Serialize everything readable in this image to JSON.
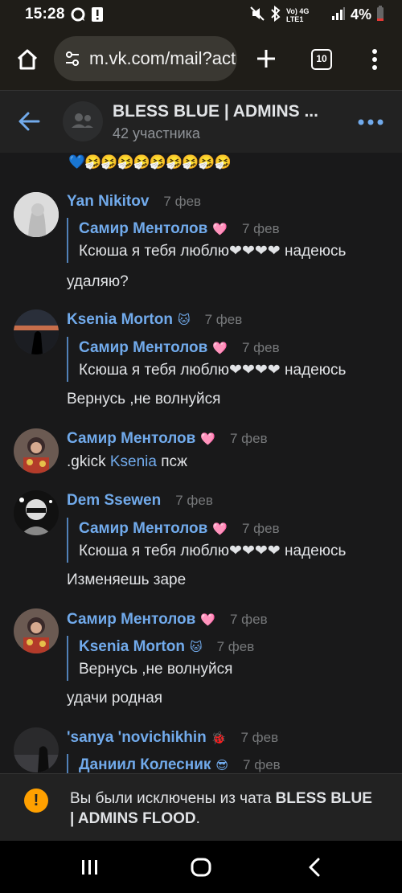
{
  "status_bar": {
    "time": "15:28",
    "network": "Vo) 4G LTE1",
    "battery": "4%"
  },
  "browser": {
    "url": "m.vk.com/mail?act",
    "tab_count": "10"
  },
  "chat": {
    "title": "BLESS BLUE | ADMINS ...",
    "subtitle": "42 участника"
  },
  "messages": {
    "top_emoji": "💙🤧🤧🤧🤧🤧🤧🤧🤧🤧",
    "m1": {
      "author": "Yan Nikitov",
      "date": "7 фев",
      "reply_author": "Самир Ментолов",
      "reply_badge": "🩷",
      "reply_date": "7 фев",
      "reply_text": "Ксюша я тебя люблю❤❤❤❤ надеюсь",
      "text": "удаляю?"
    },
    "m2": {
      "author": "Ksenia Morton",
      "badge": "🐱",
      "date": "7 фев",
      "reply_author": "Самир Ментолов",
      "reply_badge": "🩷",
      "reply_date": "7 фев",
      "reply_text": "Ксюша я тебя люблю❤❤❤❤ надеюсь",
      "text": "Вернусь ,не волнуйся"
    },
    "m3": {
      "author": "Самир Ментолов",
      "badge": "🩷",
      "date": "7 фев",
      "text_prefix": ".gkick ",
      "mention": "Ksenia",
      "text_suffix": " псж"
    },
    "m4": {
      "author": "Dem Ssewen",
      "date": "7 фев",
      "reply_author": "Самир Ментолов",
      "reply_badge": "🩷",
      "reply_date": "7 фев",
      "reply_text": "Ксюша я тебя люблю❤❤❤❤ надеюсь",
      "text": "Изменяешь заре"
    },
    "m5": {
      "author": "Самир Ментолов",
      "badge": "🩷",
      "date": "7 фев",
      "reply_author": "Ksenia Morton",
      "reply_badge": "🐱",
      "reply_date": "7 фев",
      "reply_text": "Вернусь ,не волнуйся",
      "text": "удачи родная"
    },
    "m6": {
      "author": "'sanya 'novichikhin",
      "badge": "🐞",
      "date": "7 фев",
      "reply_author": "Даниил Колесник",
      "reply_badge": "😎",
      "reply_date": "7 фев"
    }
  },
  "notice": {
    "prefix": "Вы были исключены из чата ",
    "chat_name": "BLESS BLUE | ADMINS FLOOD",
    "suffix": "."
  },
  "colors": {
    "accent": "#71aaeb",
    "background": "#19191a",
    "warning": "#ffa000"
  }
}
